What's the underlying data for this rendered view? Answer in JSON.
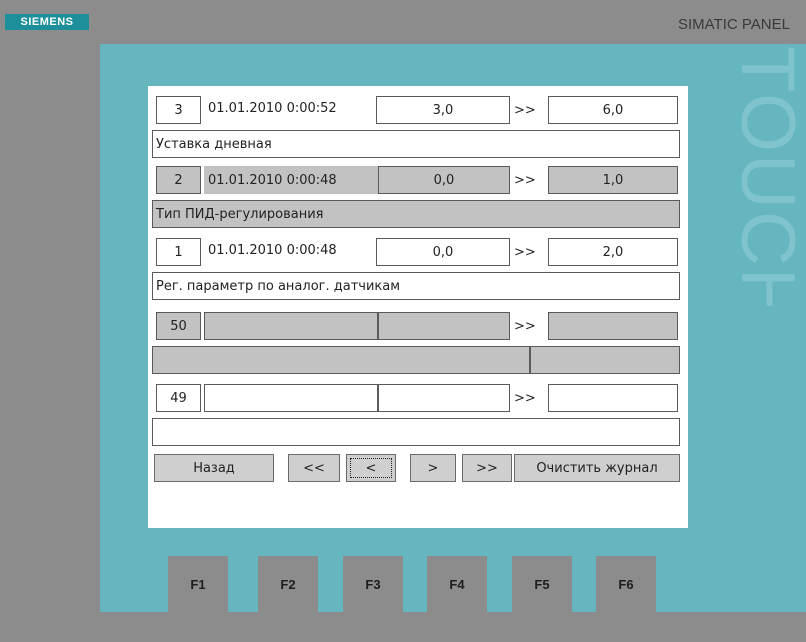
{
  "brand": {
    "logo_text": "SIEMENS",
    "panel_name": "SIMATIC PANEL",
    "touch_text": "TOUCH"
  },
  "colors": {
    "frame": "#8c8c8c",
    "bezel": "#66b6bf",
    "logo": "#1c8f9a",
    "inactive_field": "#c2c2c2",
    "screen": "#ffffff"
  },
  "entries": [
    {
      "number": "3",
      "timestamp": "01.01.2010 0:00:52",
      "old_value": "3,0",
      "arrow": ">>",
      "new_value": "6,0",
      "description": "Уставка дневная"
    },
    {
      "number": "2",
      "timestamp": "01.01.2010 0:00:48",
      "old_value": "0,0",
      "arrow": ">>",
      "new_value": "1,0",
      "description": "Тип ПИД-регулирования"
    },
    {
      "number": "1",
      "timestamp": "01.01.2010 0:00:48",
      "old_value": "0,0",
      "arrow": ">>",
      "new_value": "2,0",
      "description": "Рег. параметр по аналог. датчикам"
    },
    {
      "number": "50",
      "timestamp": "",
      "old_value": "",
      "arrow": ">>",
      "new_value": "",
      "description": ""
    },
    {
      "number": "49",
      "timestamp": "",
      "old_value": "",
      "arrow": ">>",
      "new_value": "",
      "description": ""
    }
  ],
  "nav": {
    "back": "Назад",
    "first": "<<",
    "prev": "<",
    "next": ">",
    "last": ">>",
    "clear_log": "Очистить журнал"
  },
  "function_keys": [
    "F1",
    "F2",
    "F3",
    "F4",
    "F5",
    "F6"
  ]
}
